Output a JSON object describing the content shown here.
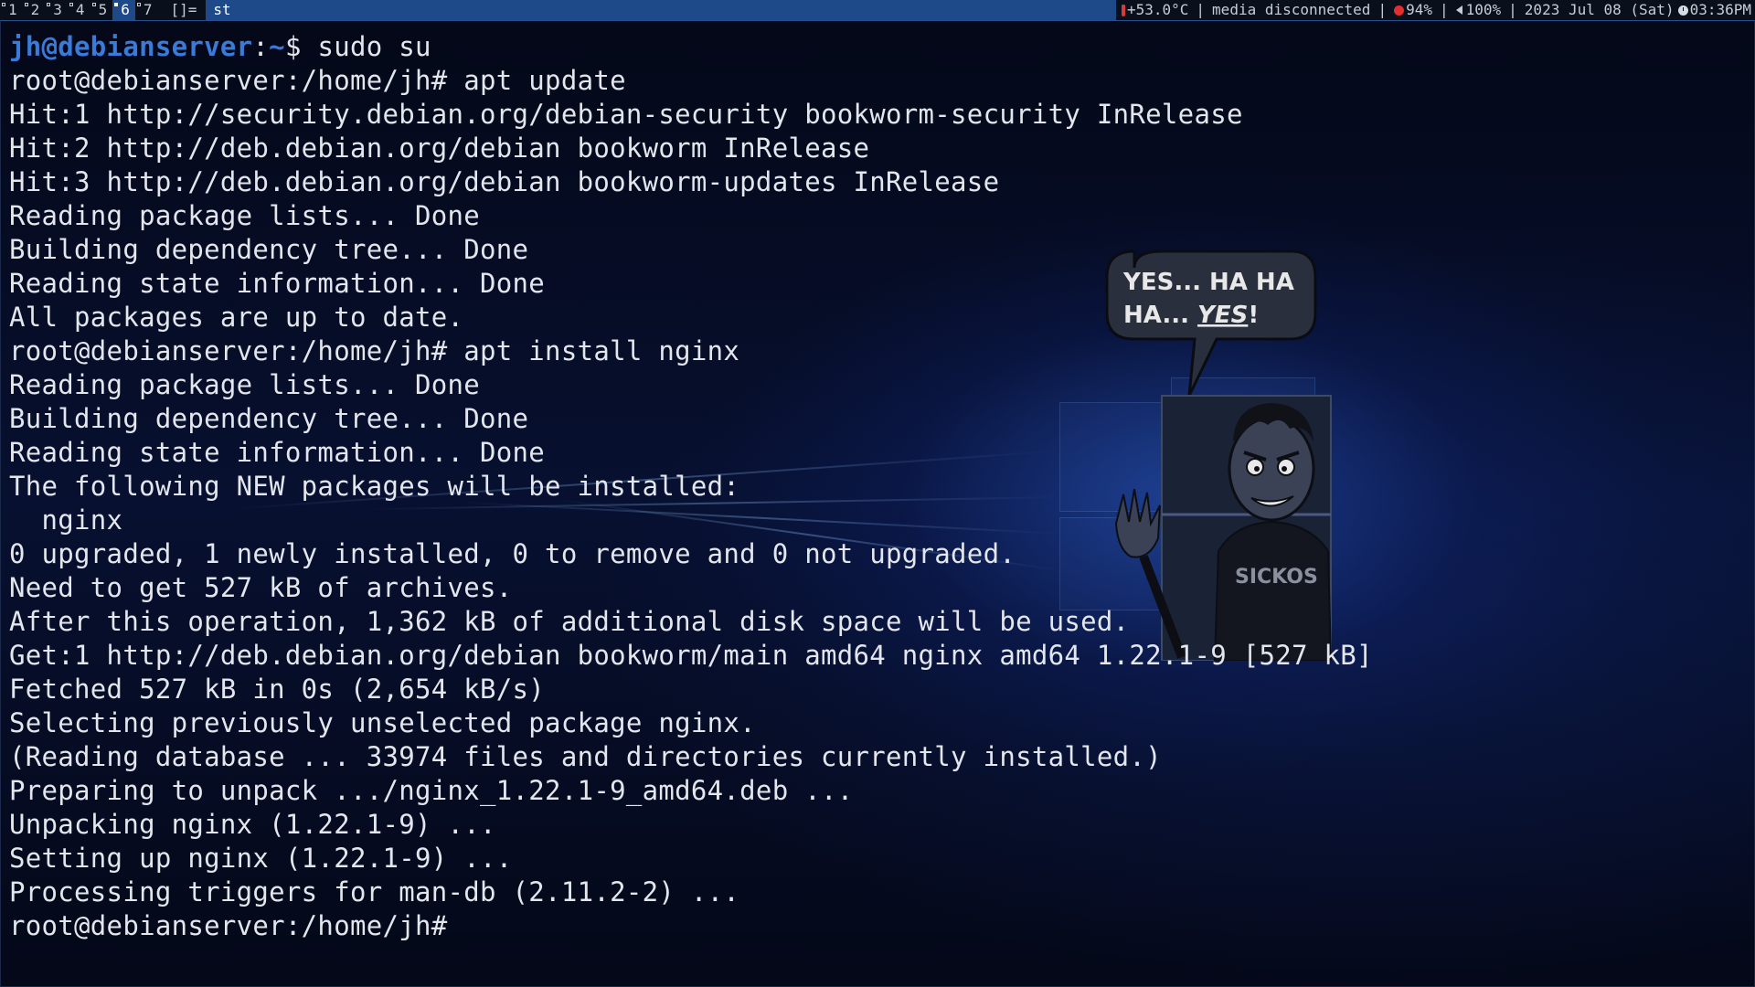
{
  "bar": {
    "tags": [
      {
        "num": "1",
        "active": false
      },
      {
        "num": "2",
        "active": false
      },
      {
        "num": "3",
        "active": false
      },
      {
        "num": "4",
        "active": false
      },
      {
        "num": "5",
        "active": false
      },
      {
        "num": "6",
        "active": true
      },
      {
        "num": "7",
        "active": false
      }
    ],
    "layout_symbol": "[]=",
    "window_title": "st",
    "status": {
      "temperature": "+53.0°C",
      "network": "media disconnected",
      "battery": "94%",
      "volume": "100%",
      "date": "2023 Jul 08 (Sat)",
      "time": "03:36PM",
      "icons": [
        "thermometer-icon",
        "battery-icon",
        "speaker-icon",
        "clock-icon"
      ],
      "colors": {
        "active_tag": "#1e4a8a",
        "thermometer": "#d83a3a",
        "battery": "#e03030"
      }
    }
  },
  "terminal": {
    "prompt": {
      "user_host": "jh@debianserver",
      "colon": ":",
      "path": "~",
      "dollar": "$",
      "command": " sudo su"
    },
    "lines": [
      "root@debianserver:/home/jh# apt update",
      "Hit:1 http://security.debian.org/debian-security bookworm-security InRelease",
      "Hit:2 http://deb.debian.org/debian bookworm InRelease",
      "Hit:3 http://deb.debian.org/debian bookworm-updates InRelease",
      "Reading package lists... Done",
      "Building dependency tree... Done",
      "Reading state information... Done",
      "All packages are up to date.",
      "root@debianserver:/home/jh# apt install nginx",
      "Reading package lists... Done",
      "Building dependency tree... Done",
      "Reading state information... Done",
      "The following NEW packages will be installed:",
      "  nginx",
      "0 upgraded, 1 newly installed, 0 to remove and 0 not upgraded.",
      "Need to get 527 kB of archives.",
      "After this operation, 1,362 kB of additional disk space will be used.",
      "Get:1 http://deb.debian.org/debian bookworm/main amd64 nginx amd64 1.22.1-9 [527 kB]",
      "Fetched 527 kB in 0s (2,654 kB/s)",
      "Selecting previously unselected package nginx.",
      "(Reading database ... 33974 files and directories currently installed.)",
      "Preparing to unpack .../nginx_1.22.1-9_amd64.deb ...",
      "Unpacking nginx (1.22.1-9) ...",
      "Setting up nginx (1.22.1-9) ...",
      "Processing triggers for man-db (2.11.2-2) ...",
      "root@debianserver:/home/jh# "
    ],
    "colors": {
      "prompt_user": "#3a7ad8",
      "foreground": "#e3e6ec"
    }
  },
  "wallpaper": {
    "speech_line1": "YES... HA HA",
    "speech_line2_a": "HA... ",
    "speech_line2_b": "YES",
    "speech_line2_c": "!",
    "shirt_text": "SICKOS"
  }
}
